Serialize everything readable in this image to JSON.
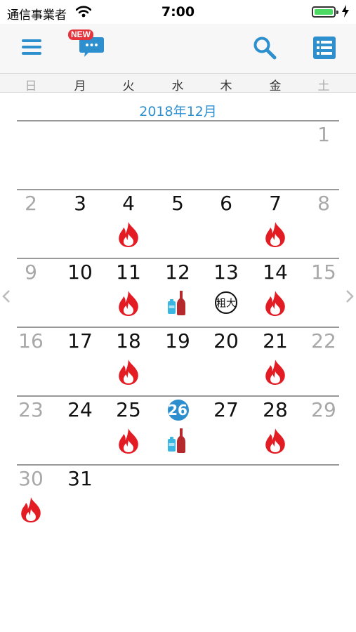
{
  "status_bar": {
    "carrier": "通信事業者",
    "time": "7:00"
  },
  "toolbar": {
    "new_badge": "NEW"
  },
  "weekdays": [
    "日",
    "月",
    "火",
    "水",
    "木",
    "金",
    "土"
  ],
  "calendar": {
    "month_title": "2018年12月",
    "today": "26",
    "weeks": [
      [
        null,
        null,
        null,
        null,
        null,
        null,
        {
          "day": "1",
          "off": true
        }
      ],
      [
        {
          "day": "2",
          "off": true
        },
        {
          "day": "3"
        },
        {
          "day": "4",
          "icon": "burnable"
        },
        {
          "day": "5"
        },
        {
          "day": "6"
        },
        {
          "day": "7",
          "icon": "burnable"
        },
        {
          "day": "8",
          "off": true
        }
      ],
      [
        {
          "day": "9",
          "off": true
        },
        {
          "day": "10"
        },
        {
          "day": "11",
          "icon": "burnable"
        },
        {
          "day": "12",
          "icon": "bottles"
        },
        {
          "day": "13",
          "icon": "bulky",
          "icon_label": "粗大"
        },
        {
          "day": "14",
          "icon": "burnable"
        },
        {
          "day": "15",
          "off": true
        }
      ],
      [
        {
          "day": "16",
          "off": true
        },
        {
          "day": "17"
        },
        {
          "day": "18",
          "icon": "burnable"
        },
        {
          "day": "19"
        },
        {
          "day": "20"
        },
        {
          "day": "21",
          "icon": "burnable"
        },
        {
          "day": "22",
          "off": true
        }
      ],
      [
        {
          "day": "23",
          "off": true
        },
        {
          "day": "24"
        },
        {
          "day": "25",
          "icon": "burnable"
        },
        {
          "day": "26",
          "today": true,
          "icon": "bottles"
        },
        {
          "day": "27"
        },
        {
          "day": "28",
          "icon": "burnable"
        },
        {
          "day": "29",
          "off": true
        }
      ],
      [
        {
          "day": "30",
          "off": true,
          "icon": "burnable"
        },
        {
          "day": "31"
        },
        null,
        null,
        null,
        null,
        null
      ]
    ]
  },
  "colors": {
    "accent": "#2e8fcf",
    "flame_red": "#e31b23",
    "bottle_blue": "#3ab6e0",
    "bottle_brown": "#b3292c"
  }
}
